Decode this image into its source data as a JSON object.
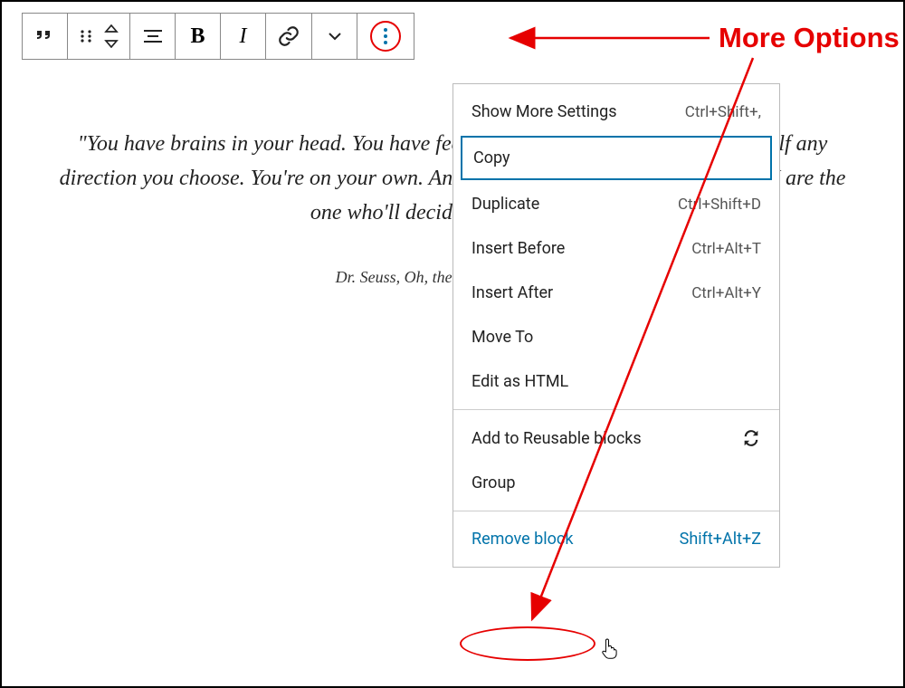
{
  "toolbar": {
    "bold_glyph": "B",
    "italic_glyph": "I"
  },
  "quote": {
    "text": "\"You have brains in your head. You have feet in your shoes. You can steer yourself any direction you choose. You're on your own. And you know what you know. And YOU are the one who'll decide where to go...\"",
    "citation": "Dr. Seuss, Oh, the Places You'll Go!"
  },
  "menu": {
    "show_more_settings": {
      "label": "Show More Settings",
      "shortcut": "Ctrl+Shift+,"
    },
    "copy": {
      "label": "Copy"
    },
    "duplicate": {
      "label": "Duplicate",
      "shortcut": "Ctrl+Shift+D"
    },
    "insert_before": {
      "label": "Insert Before",
      "shortcut": "Ctrl+Alt+T"
    },
    "insert_after": {
      "label": "Insert After",
      "shortcut": "Ctrl+Alt+Y"
    },
    "move_to": {
      "label": "Move To"
    },
    "edit_html": {
      "label": "Edit as HTML"
    },
    "add_reusable": {
      "label": "Add to Reusable blocks"
    },
    "group": {
      "label": "Group"
    },
    "remove": {
      "label": "Remove block",
      "shortcut": "Shift+Alt+Z"
    }
  },
  "annotations": {
    "more_options_label": "More Options"
  }
}
